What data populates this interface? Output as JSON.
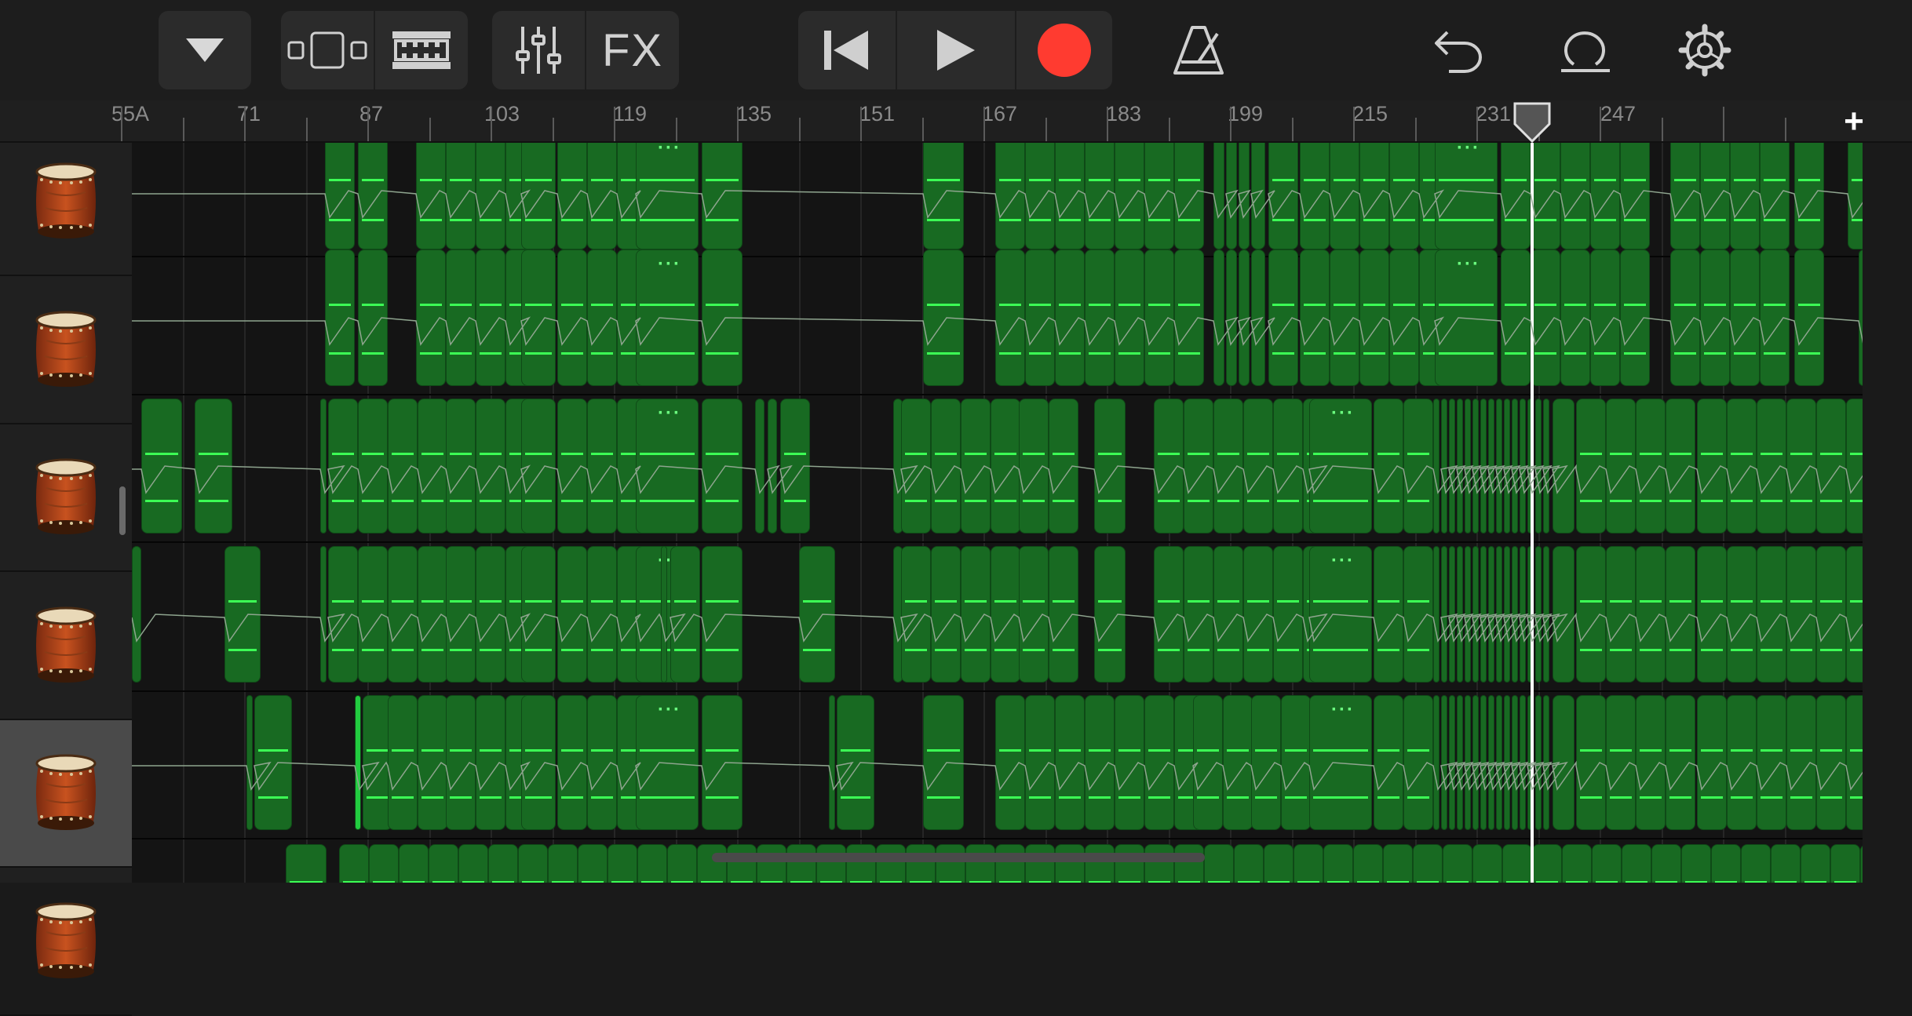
{
  "toolbar": {
    "view_menu_icon": "triangle-down-icon",
    "tracks_view_icon": "tracks-view-icon",
    "instrument_view_icon": "taiko-drum-view-icon",
    "mixer_icon": "sliders-icon",
    "fx_label": "FX",
    "rewind_icon": "skip-to-start-icon",
    "play_icon": "play-icon",
    "record_icon": "record-icon",
    "record_color": "#ff3b30",
    "metronome_icon": "metronome-icon",
    "undo_icon": "undo-icon",
    "loop_icon": "loop-icon",
    "settings_icon": "gear-icon"
  },
  "ruler": {
    "section_marker": "A",
    "labels": [
      "55",
      "71",
      "87",
      "103",
      "119",
      "135",
      "151",
      "167",
      "183",
      "199",
      "215",
      "231",
      "247"
    ],
    "add_section_label": "+"
  },
  "tracks": [
    {
      "instrument_icon": "taiko-drum-icon",
      "selected": false
    },
    {
      "instrument_icon": "taiko-drum-icon",
      "selected": false
    },
    {
      "instrument_icon": "taiko-drum-icon",
      "selected": false
    },
    {
      "instrument_icon": "taiko-drum-icon",
      "selected": false
    },
    {
      "instrument_icon": "taiko-drum-icon",
      "selected": true
    },
    {
      "instrument_icon": "taiko-drum-icon",
      "selected": false
    }
  ],
  "colors": {
    "region": "#186a22",
    "region_selected": "#22cc40",
    "note": "#3cff55",
    "playhead": "#ffffff"
  }
}
